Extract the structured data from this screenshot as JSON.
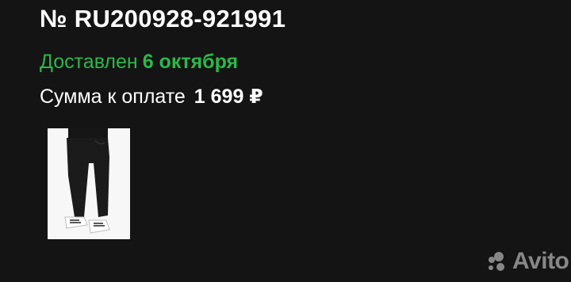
{
  "order": {
    "number": "№ RU200928-921991",
    "status_word": "Доставлен",
    "status_date": "6 октября",
    "sum_label": "Сумма к оплате",
    "sum_value": "1 699 ₽"
  },
  "product": {
    "image_icon": "jeans-product-photo"
  },
  "watermark": {
    "brand": "Avito"
  },
  "colors": {
    "background": "#141414",
    "text": "#ffffff",
    "accent_green": "#2bb84a"
  }
}
